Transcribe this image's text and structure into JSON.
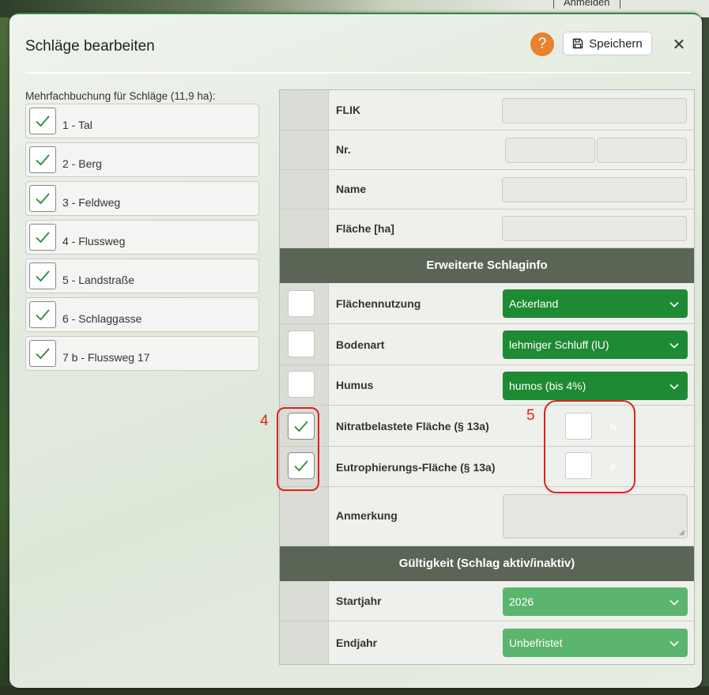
{
  "background": {
    "anmelden_label": "Anmelden"
  },
  "dialog": {
    "title": "Schläge bearbeiten",
    "help_label": "?",
    "save_label": "Speichern",
    "close_label": "✕"
  },
  "multi": {
    "label": "Mehrfachbuchung für Schläge (11,9 ha):",
    "items": [
      {
        "label": "1 - Tal",
        "checked": true
      },
      {
        "label": "2 - Berg",
        "checked": true
      },
      {
        "label": "3 - Feldweg",
        "checked": true
      },
      {
        "label": "4 - Flussweg",
        "checked": true
      },
      {
        "label": "5 - Landstraße",
        "checked": true
      },
      {
        "label": "6 - Schlaggasse",
        "checked": true
      },
      {
        "label": "7 b - Flussweg 17",
        "checked": true
      }
    ]
  },
  "form": {
    "flik_label": "FLIK",
    "nr_label": "Nr.",
    "name_label": "Name",
    "flaeche_label": "Fläche [ha]",
    "section_extended": "Erweiterte Schlaginfo",
    "flaechennutzung_label": "Flächennutzung",
    "flaechennutzung_value": "Ackerland",
    "bodenart_label": "Bodenart",
    "bodenart_value": "lehmiger Schluff (lU)",
    "humus_label": "Humus",
    "humus_value": "humos (bis 4%)",
    "nitrat_label": "Nitratbelastete Fläche (§ 13a)",
    "nitrat_tag": "N",
    "eutro_label": "Eutrophierungs-Fläche (§ 13a)",
    "eutro_tag": "P",
    "anmerkung_label": "Anmerkung",
    "section_validity": "Gültigkeit (Schlag aktiv/inaktiv)",
    "startjahr_label": "Startjahr",
    "startjahr_value": "2026",
    "endjahr_label": "Endjahr",
    "endjahr_value": "Unbefristet"
  },
  "annotations": {
    "label_4": "4",
    "label_5": "5"
  },
  "colors": {
    "accent_green": "#1e8a33",
    "light_green": "#5cb56e",
    "help_orange": "#e8822c",
    "annotation_red": "#e02020",
    "section_header": "#5b6555"
  },
  "icons": [
    "floppy-disk-icon",
    "close-icon",
    "checkmark-icon",
    "chevron-down-icon",
    "resize-grip-icon"
  ]
}
